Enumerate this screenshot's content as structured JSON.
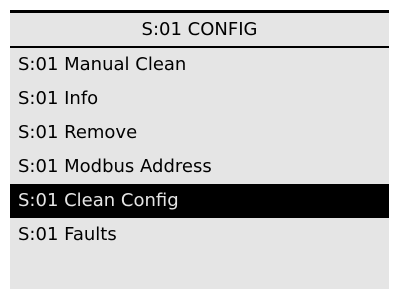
{
  "header": {
    "title": "S:01 CONFIG"
  },
  "menu": {
    "items": [
      {
        "label": "S:01 Manual Clean",
        "selected": false
      },
      {
        "label": "S:01 Info",
        "selected": false
      },
      {
        "label": "S:01 Remove",
        "selected": false
      },
      {
        "label": "S:01 Modbus Address",
        "selected": false
      },
      {
        "label": "S:01 Clean Config",
        "selected": true
      },
      {
        "label": "S:01 Faults",
        "selected": false
      }
    ]
  },
  "colors": {
    "screen_background": "#e5e5e5",
    "text": "#000000",
    "selection_background": "#000000",
    "selection_text": "#e5e5e5"
  }
}
